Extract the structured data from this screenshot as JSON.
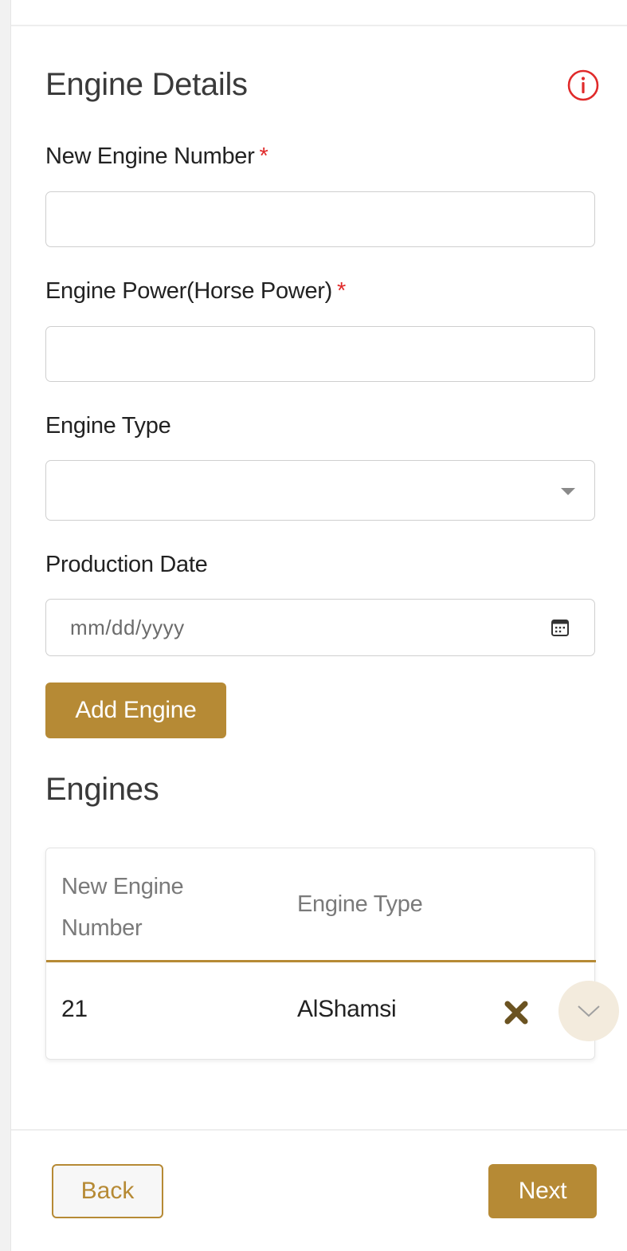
{
  "engine_details": {
    "title": "Engine Details",
    "info_icon": "info-circle-icon",
    "required_marker": "*",
    "fields": {
      "engine_number": {
        "label": "New Engine Number",
        "required": true,
        "value": ""
      },
      "engine_power": {
        "label": "Engine Power(Horse Power)",
        "required": true,
        "value": ""
      },
      "engine_type": {
        "label": "Engine Type",
        "selected": ""
      },
      "production_date": {
        "label": "Production Date",
        "placeholder": "mm/dd/yyyy"
      }
    },
    "add_button": "Add Engine"
  },
  "engines": {
    "title": "Engines",
    "columns": [
      "New Engine Number",
      "Engine Type"
    ],
    "rows": [
      {
        "engine_number": "21",
        "engine_type": "AlShamsi"
      }
    ]
  },
  "footer": {
    "back_label": "Back",
    "next_label": "Next"
  },
  "colors": {
    "accent": "#b68a35",
    "required": "#e02a2a",
    "info": "#e02a2a"
  }
}
